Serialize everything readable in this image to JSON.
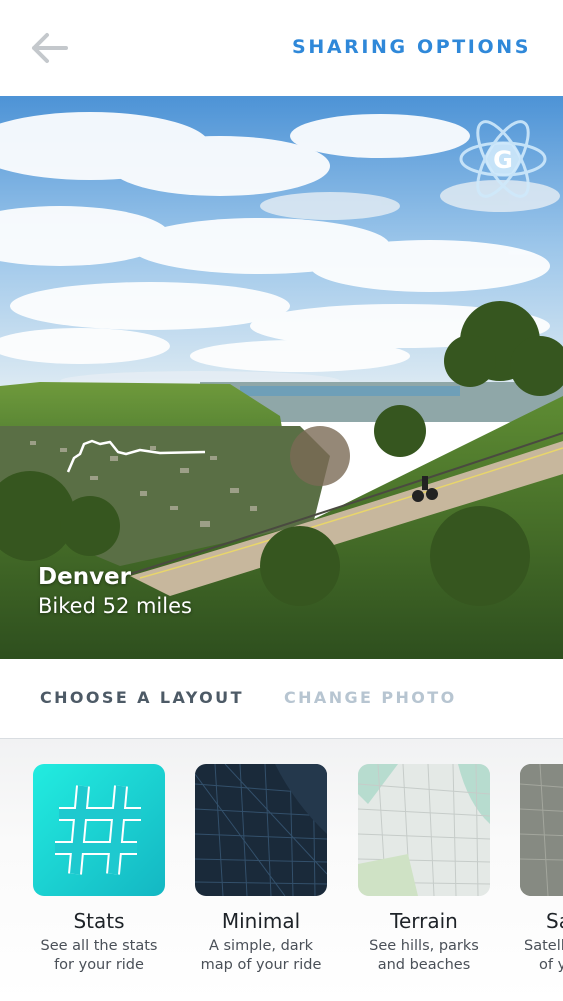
{
  "header": {
    "back_icon": "arrow-left-icon",
    "sharing_options": "SHARING OPTIONS",
    "accent_color": "#2f88d9"
  },
  "hero": {
    "city": "Denver",
    "activity": "Biked 52 miles",
    "badge_icon": "g-atom-logo-icon"
  },
  "tabs": {
    "choose_layout": "CHOOSE A LAYOUT",
    "change_photo": "CHANGE PHOTO"
  },
  "layouts": [
    {
      "title": "Stats",
      "desc_line1": "See all the stats",
      "desc_line2": "for your ride",
      "icon": "hashtag-icon"
    },
    {
      "title": "Minimal",
      "desc_line1": "A simple, dark",
      "desc_line2": "map of your ride",
      "icon": "dark-map-icon"
    },
    {
      "title": "Terrain",
      "desc_line1": "See hills, parks",
      "desc_line2": "and beaches",
      "icon": "terrain-map-icon"
    },
    {
      "title": "Sa",
      "desc_line1": "Satell",
      "desc_line2": "of y",
      "icon": "satellite-map-icon"
    }
  ]
}
